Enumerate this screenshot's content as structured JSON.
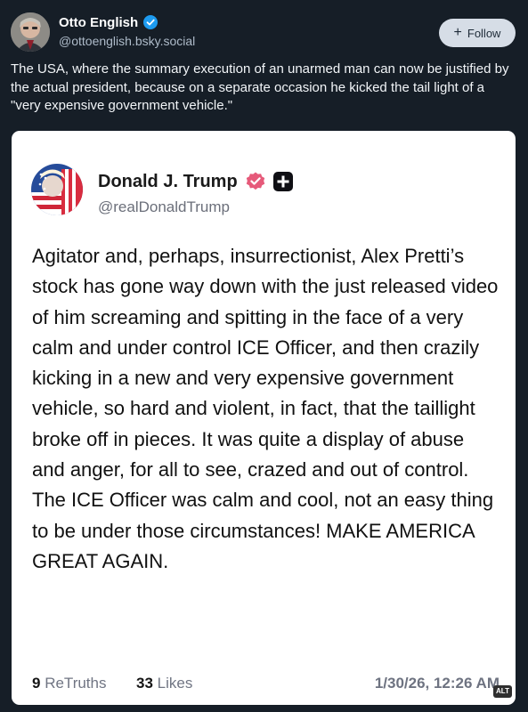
{
  "post": {
    "author_name": "Otto English",
    "author_handle": "@ottoenglish.bsky.social",
    "follow_label": "Follow",
    "follow_icon": "+",
    "text": "The USA, where the summary execution of an unarmed man can now be justified by the actual president, because on a separate occasion he kicked the tail light of a \"very expensive government vehicle.\"",
    "verified_icon": "verified-badge-icon",
    "accent_color": "#1d9bf0"
  },
  "truth": {
    "author_name": "Donald J. Trump",
    "author_handle": "@realDonaldTrump",
    "verified_icon": "pink-verified-badge-icon",
    "plus_icon": "truth-social-plus-icon",
    "badge_color": "#e65a7a",
    "text": "Agitator and, perhaps, insurrectionist, Alex Pretti’s stock has gone way down with the just released video of him screaming and spitting in the face of a very calm and under control ICE Officer, and then crazily kicking in a new and very expensive government vehicle, so hard and violent, in fact, that the taillight broke off in pieces. It was quite a display of abuse and anger, for all to see, crazed and out of control. The ICE Officer was calm and cool, not an easy thing to be under those circumstances! MAKE AMERICA GREAT AGAIN.",
    "retruths_count": "9",
    "retruths_label": "ReTruths",
    "likes_count": "33",
    "likes_label": "Likes",
    "timestamp": "1/30/26, 12:26 AM"
  },
  "alt_badge": "ALT"
}
